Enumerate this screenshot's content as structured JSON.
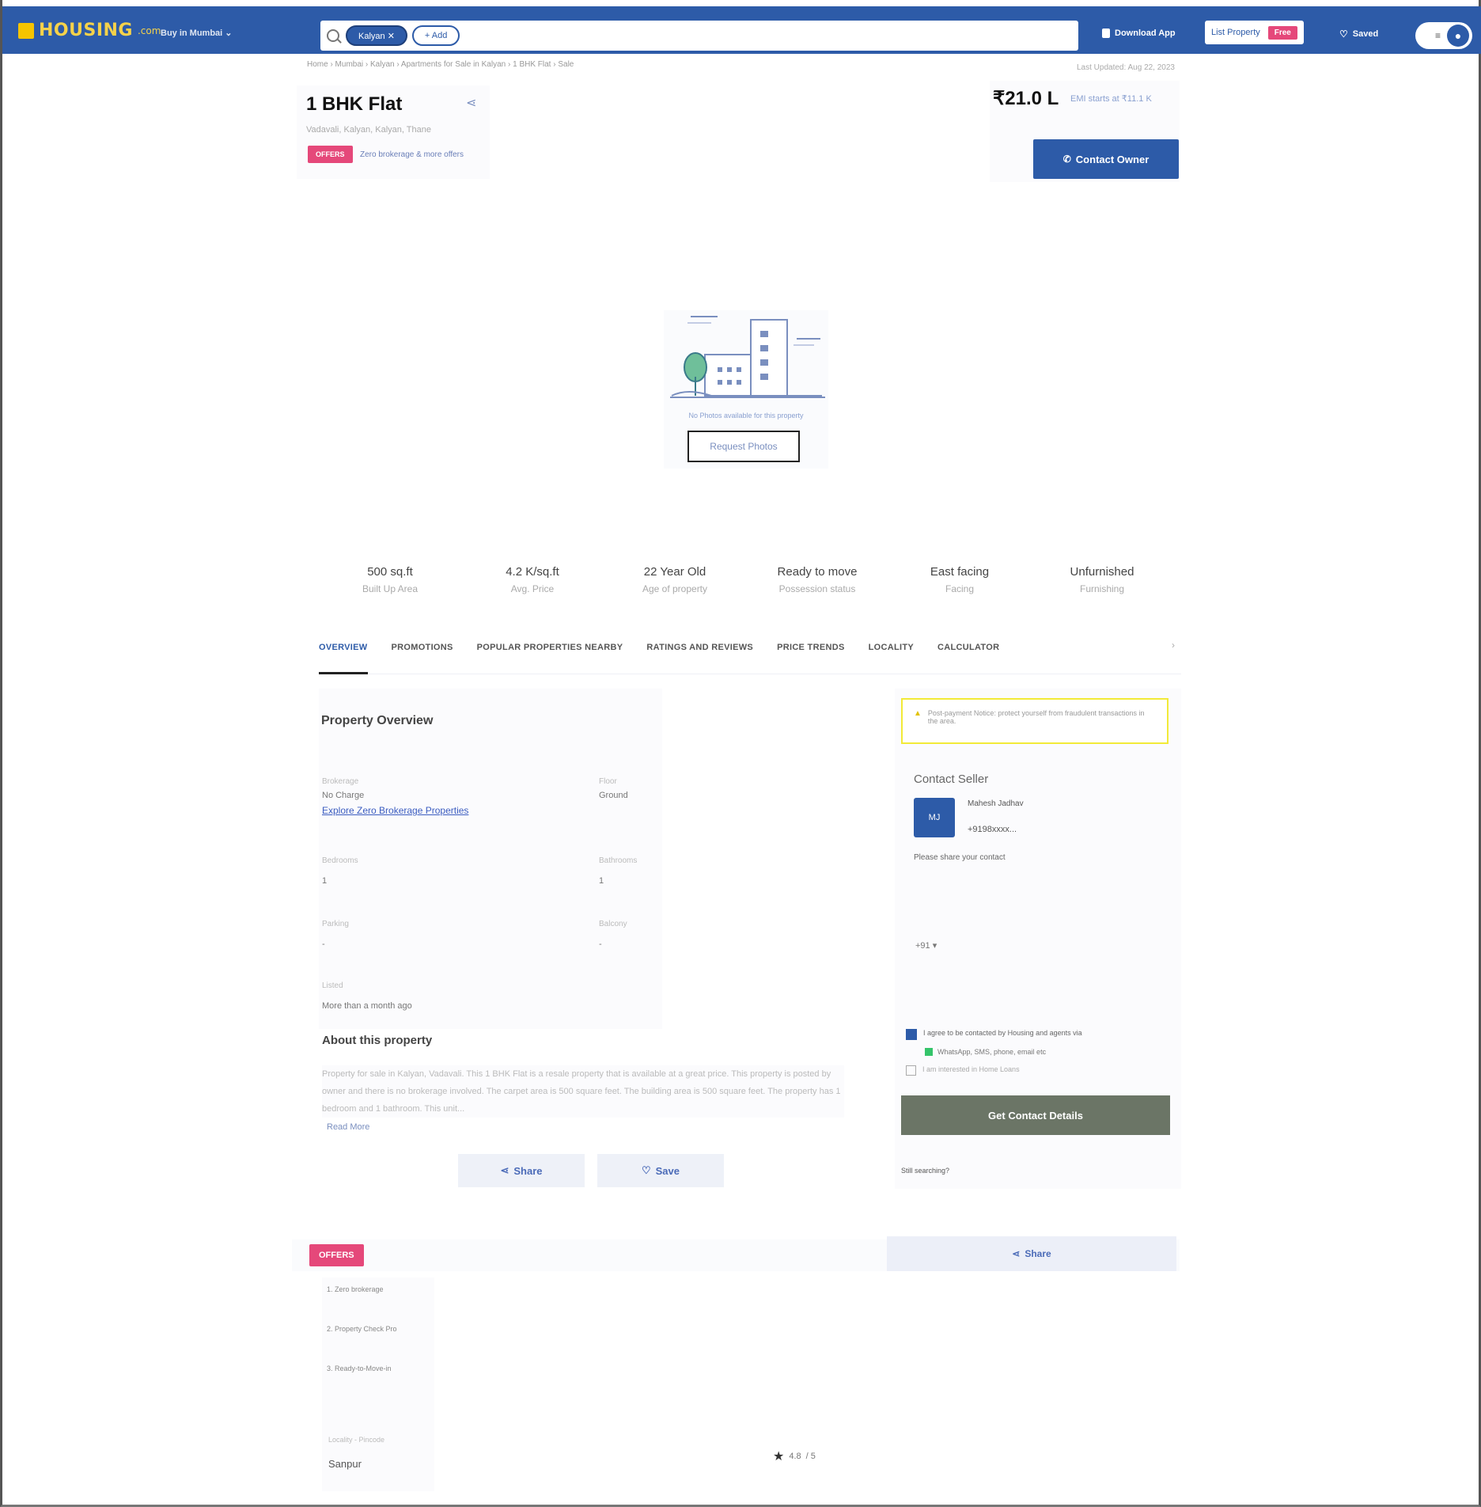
{
  "header": {
    "logo_text": "HOUSING",
    "logo_suffix": ".com",
    "buy_menu": "Buy in Mumbai ⌄",
    "search_chips": [
      "Kalyan ✕",
      "+ Add"
    ],
    "download_app": "Download App",
    "list_property": "List Property",
    "free_badge": "Free",
    "saved": "Saved",
    "menu_icon": "menu-icon",
    "avatar_icon": "user-icon"
  },
  "breadcrumb": "Home › Mumbai › Kalyan › Apartments for Sale in Kalyan › 1 BHK Flat › Sale",
  "last_updated": "Last Updated: Aug 22, 2023",
  "listing": {
    "title": "1 BHK Flat",
    "locality": "Vadavali, Kalyan, Kalyan, Thane",
    "rera_badge": "OFFERS",
    "brokerage_note": "Zero brokerage & more offers",
    "price": "₹21.0 L",
    "emi": "EMI starts at ₹11.1 K",
    "contact_owner": "Contact Owner"
  },
  "photo": {
    "no_photo_text": "No Photos available for this property",
    "request_photos": "Request Photos"
  },
  "facts": [
    {
      "value": "500 sq.ft",
      "label": "Built Up Area"
    },
    {
      "value": "4.2 K/sq.ft",
      "label": "Avg. Price"
    },
    {
      "value": "22 Year Old",
      "label": "Age of property"
    },
    {
      "value": "Ready to move",
      "label": "Possession status"
    },
    {
      "value": "East facing",
      "label": "Facing"
    },
    {
      "value": "Unfurnished",
      "label": "Furnishing"
    }
  ],
  "tabs": [
    "OVERVIEW",
    "PROMOTIONS",
    "POPULAR PROPERTIES NEARBY",
    "RATINGS AND REVIEWS",
    "PRICE TRENDS",
    "LOCALITY",
    "CALCULATOR"
  ],
  "overview": {
    "section_title": "Property Overview",
    "brokerage_label": "Brokerage",
    "brokerage_value": "No Charge",
    "brokerage_link": "Explore Zero Brokerage Properties",
    "floor_label": "Floor",
    "floor_value": "Ground",
    "bedrooms_label": "Bedrooms",
    "bedrooms_value": "1",
    "bathrooms_label": "Bathrooms",
    "bathrooms_value": "1",
    "parking_label": "Parking",
    "parking_value": "-",
    "balcony_label": "Balcony",
    "balcony_value": "-",
    "listed_label": "Listed",
    "listed_value": "More than a month ago"
  },
  "about": {
    "title": "About this property",
    "text": "Property for sale in Kalyan, Vadavali. This 1 BHK Flat is a resale property that is available at a great price. This property is posted by owner and there is no brokerage involved. The carpet area is 500 square feet. The building area is 500 square feet. The property has 1 bedroom and 1 bathroom. This unit...",
    "read_more": "Read More",
    "share": "Share",
    "save": "Save"
  },
  "contact_card": {
    "notice": "Post-payment Notice: protect yourself from fraudulent transactions in the area.",
    "title": "Contact Seller",
    "avatar_initials": "MJ",
    "seller_name": "Mahesh Jadhav",
    "seller_phone": "+9198xxxx...",
    "share_info": "Please share your contact",
    "country_code": "+91 ▾",
    "consent": "I agree to be contacted by Housing and agents via",
    "whatsapp": "WhatsApp, SMS, phone, email etc",
    "loan": "I am interested in Home Loans",
    "get_contact": "Get Contact Details",
    "still_searching": "Still searching?"
  },
  "offers": {
    "badge": "OFFERS",
    "share": "Share",
    "items": [
      "1. Zero brokerage",
      "2. Property Check Pro",
      "3. Ready-to-Move-in"
    ],
    "locality_label": "Locality - Pincode",
    "locality_value": "Sanpur"
  },
  "rating": {
    "value": "4.8",
    "suffix": "/ 5"
  },
  "colors": {
    "brand_blue": "#2d5ba8",
    "logo_yellow": "#f5c400",
    "pink": "#e5487a",
    "cta_gray": "#6b7566"
  }
}
